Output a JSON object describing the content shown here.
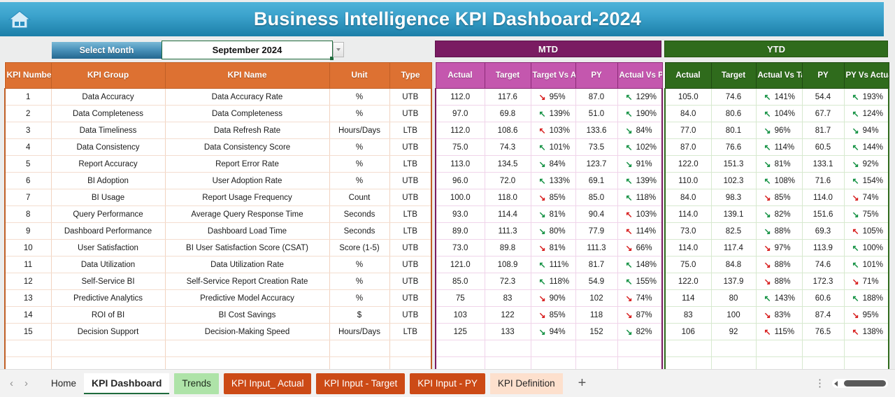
{
  "header": {
    "title": "Business Intelligence KPI Dashboard-2024",
    "home_icon": "home-icon"
  },
  "controls": {
    "select_month_label": "Select Month",
    "month_value": "September 2024",
    "dropdown_icon": "chevron-down-icon"
  },
  "groups": {
    "mtd": "MTD",
    "ytd": "YTD"
  },
  "columns": {
    "left": [
      "KPI Number",
      "KPI Group",
      "KPI Name",
      "Unit",
      "Type"
    ],
    "mtd": [
      "Actual",
      "Target",
      "Target Vs Actual",
      "PY",
      "Actual Vs PY"
    ],
    "ytd": [
      "Actual",
      "Target",
      "Actual Vs Target",
      "PY",
      "PY Vs Actual"
    ]
  },
  "rows": [
    {
      "n": "1",
      "group": "Data Accuracy",
      "name": "Data Accuracy Rate",
      "unit": "%",
      "type": "UTB",
      "mtd": {
        "actual": "112.0",
        "target": "117.6",
        "tva": "95%",
        "tva_dir": "down",
        "tva_col": "dn",
        "py": "87.0",
        "avp": "129%",
        "avp_dir": "up",
        "avp_col": "up"
      },
      "ytd": {
        "actual": "105.0",
        "target": "74.6",
        "avt": "141%",
        "avt_dir": "up",
        "avt_col": "up",
        "py": "54.4",
        "pva": "193%",
        "pva_dir": "up",
        "pva_col": "up"
      }
    },
    {
      "n": "2",
      "group": "Data Completeness",
      "name": "Data Completeness",
      "unit": "%",
      "type": "UTB",
      "mtd": {
        "actual": "97.0",
        "target": "69.8",
        "tva": "139%",
        "tva_dir": "up",
        "tva_col": "up",
        "py": "51.0",
        "avp": "190%",
        "avp_dir": "up",
        "avp_col": "up"
      },
      "ytd": {
        "actual": "84.0",
        "target": "80.6",
        "avt": "104%",
        "avt_dir": "up",
        "avt_col": "up",
        "py": "67.7",
        "pva": "124%",
        "pva_dir": "up",
        "pva_col": "up"
      }
    },
    {
      "n": "3",
      "group": "Data Timeliness",
      "name": "Data Refresh Rate",
      "unit": "Hours/Days",
      "type": "LTB",
      "mtd": {
        "actual": "112.0",
        "target": "108.6",
        "tva": "103%",
        "tva_dir": "up",
        "tva_col": "dn",
        "py": "133.6",
        "avp": "84%",
        "avp_dir": "down",
        "avp_col": "up"
      },
      "ytd": {
        "actual": "77.0",
        "target": "80.1",
        "avt": "96%",
        "avt_dir": "down",
        "avt_col": "up",
        "py": "81.7",
        "pva": "94%",
        "pva_dir": "down",
        "pva_col": "up"
      }
    },
    {
      "n": "4",
      "group": "Data Consistency",
      "name": "Data Consistency Score",
      "unit": "%",
      "type": "UTB",
      "mtd": {
        "actual": "75.0",
        "target": "74.3",
        "tva": "101%",
        "tva_dir": "up",
        "tva_col": "up",
        "py": "73.5",
        "avp": "102%",
        "avp_dir": "up",
        "avp_col": "up"
      },
      "ytd": {
        "actual": "87.0",
        "target": "76.6",
        "avt": "114%",
        "avt_dir": "up",
        "avt_col": "up",
        "py": "60.5",
        "pva": "144%",
        "pva_dir": "up",
        "pva_col": "up"
      }
    },
    {
      "n": "5",
      "group": "Report Accuracy",
      "name": "Report Error Rate",
      "unit": "%",
      "type": "LTB",
      "mtd": {
        "actual": "113.0",
        "target": "134.5",
        "tva": "84%",
        "tva_dir": "down",
        "tva_col": "up",
        "py": "123.7",
        "avp": "91%",
        "avp_dir": "down",
        "avp_col": "up"
      },
      "ytd": {
        "actual": "122.0",
        "target": "151.3",
        "avt": "81%",
        "avt_dir": "down",
        "avt_col": "up",
        "py": "133.1",
        "pva": "92%",
        "pva_dir": "down",
        "pva_col": "up"
      }
    },
    {
      "n": "6",
      "group": "BI Adoption",
      "name": "User Adoption Rate",
      "unit": "%",
      "type": "UTB",
      "mtd": {
        "actual": "96.0",
        "target": "72.0",
        "tva": "133%",
        "tva_dir": "up",
        "tva_col": "up",
        "py": "69.1",
        "avp": "139%",
        "avp_dir": "up",
        "avp_col": "up"
      },
      "ytd": {
        "actual": "110.0",
        "target": "102.3",
        "avt": "108%",
        "avt_dir": "up",
        "avt_col": "up",
        "py": "71.6",
        "pva": "154%",
        "pva_dir": "up",
        "pva_col": "up"
      }
    },
    {
      "n": "7",
      "group": "BI Usage",
      "name": "Report Usage Frequency",
      "unit": "Count",
      "type": "UTB",
      "mtd": {
        "actual": "100.0",
        "target": "118.0",
        "tva": "85%",
        "tva_dir": "down",
        "tva_col": "dn",
        "py": "85.0",
        "avp": "118%",
        "avp_dir": "up",
        "avp_col": "up"
      },
      "ytd": {
        "actual": "84.0",
        "target": "98.3",
        "avt": "85%",
        "avt_dir": "down",
        "avt_col": "dn",
        "py": "114.0",
        "pva": "74%",
        "pva_dir": "down",
        "pva_col": "dn"
      }
    },
    {
      "n": "8",
      "group": "Query Performance",
      "name": "Average Query Response Time",
      "unit": "Seconds",
      "type": "LTB",
      "mtd": {
        "actual": "93.0",
        "target": "114.4",
        "tva": "81%",
        "tva_dir": "down",
        "tva_col": "up",
        "py": "90.4",
        "avp": "103%",
        "avp_dir": "up",
        "avp_col": "dn"
      },
      "ytd": {
        "actual": "114.0",
        "target": "139.1",
        "avt": "82%",
        "avt_dir": "down",
        "avt_col": "up",
        "py": "151.6",
        "pva": "75%",
        "pva_dir": "down",
        "pva_col": "up"
      }
    },
    {
      "n": "9",
      "group": "Dashboard Performance",
      "name": "Dashboard Load Time",
      "unit": "Seconds",
      "type": "LTB",
      "mtd": {
        "actual": "89.0",
        "target": "111.3",
        "tva": "80%",
        "tva_dir": "down",
        "tva_col": "up",
        "py": "77.9",
        "avp": "114%",
        "avp_dir": "up",
        "avp_col": "dn"
      },
      "ytd": {
        "actual": "73.0",
        "target": "82.5",
        "avt": "88%",
        "avt_dir": "down",
        "avt_col": "up",
        "py": "69.3",
        "pva": "105%",
        "pva_dir": "up",
        "pva_col": "dn"
      }
    },
    {
      "n": "10",
      "group": "User Satisfaction",
      "name": "BI User Satisfaction Score (CSAT)",
      "unit": "Score (1-5)",
      "type": "UTB",
      "mtd": {
        "actual": "73.0",
        "target": "89.8",
        "tva": "81%",
        "tva_dir": "down",
        "tva_col": "dn",
        "py": "111.3",
        "avp": "66%",
        "avp_dir": "down",
        "avp_col": "dn"
      },
      "ytd": {
        "actual": "114.0",
        "target": "117.4",
        "avt": "97%",
        "avt_dir": "down",
        "avt_col": "dn",
        "py": "113.9",
        "pva": "100%",
        "pva_dir": "up",
        "pva_col": "up"
      }
    },
    {
      "n": "11",
      "group": "Data Utilization",
      "name": "Data Utilization Rate",
      "unit": "%",
      "type": "UTB",
      "mtd": {
        "actual": "121.0",
        "target": "108.9",
        "tva": "111%",
        "tva_dir": "up",
        "tva_col": "up",
        "py": "81.7",
        "avp": "148%",
        "avp_dir": "up",
        "avp_col": "up"
      },
      "ytd": {
        "actual": "75.0",
        "target": "84.8",
        "avt": "88%",
        "avt_dir": "down",
        "avt_col": "dn",
        "py": "74.6",
        "pva": "101%",
        "pva_dir": "up",
        "pva_col": "up"
      }
    },
    {
      "n": "12",
      "group": "Self-Service BI",
      "name": "Self-Service Report Creation Rate",
      "unit": "%",
      "type": "UTB",
      "mtd": {
        "actual": "85.0",
        "target": "72.3",
        "tva": "118%",
        "tva_dir": "up",
        "tva_col": "up",
        "py": "54.9",
        "avp": "155%",
        "avp_dir": "up",
        "avp_col": "up"
      },
      "ytd": {
        "actual": "122.0",
        "target": "137.9",
        "avt": "88%",
        "avt_dir": "down",
        "avt_col": "dn",
        "py": "172.3",
        "pva": "71%",
        "pva_dir": "down",
        "pva_col": "dn"
      }
    },
    {
      "n": "13",
      "group": "Predictive Analytics",
      "name": "Predictive Model Accuracy",
      "unit": "%",
      "type": "UTB",
      "mtd": {
        "actual": "75",
        "target": "83",
        "tva": "90%",
        "tva_dir": "down",
        "tva_col": "dn",
        "py": "102",
        "avp": "74%",
        "avp_dir": "down",
        "avp_col": "dn"
      },
      "ytd": {
        "actual": "114",
        "target": "80",
        "avt": "143%",
        "avt_dir": "up",
        "avt_col": "up",
        "py": "60.6",
        "pva": "188%",
        "pva_dir": "up",
        "pva_col": "up"
      }
    },
    {
      "n": "14",
      "group": "ROI of BI",
      "name": "BI Cost Savings",
      "unit": "$",
      "type": "UTB",
      "mtd": {
        "actual": "103",
        "target": "122",
        "tva": "85%",
        "tva_dir": "down",
        "tva_col": "dn",
        "py": "118",
        "avp": "87%",
        "avp_dir": "down",
        "avp_col": "dn"
      },
      "ytd": {
        "actual": "83",
        "target": "100",
        "avt": "83%",
        "avt_dir": "down",
        "avt_col": "dn",
        "py": "87.4",
        "pva": "95%",
        "pva_dir": "down",
        "pva_col": "dn"
      }
    },
    {
      "n": "15",
      "group": "Decision Support",
      "name": "Decision-Making Speed",
      "unit": "Hours/Days",
      "type": "LTB",
      "mtd": {
        "actual": "125",
        "target": "133",
        "tva": "94%",
        "tva_dir": "down",
        "tva_col": "up",
        "py": "152",
        "avp": "82%",
        "avp_dir": "down",
        "avp_col": "up"
      },
      "ytd": {
        "actual": "106",
        "target": "92",
        "avt": "115%",
        "avt_dir": "up",
        "avt_col": "dn",
        "py": "76.5",
        "pva": "138%",
        "pva_dir": "up",
        "pva_col": "dn"
      }
    }
  ],
  "tabbar": {
    "prev_icon": "chevron-left-icon",
    "next_icon": "chevron-right-icon",
    "tabs": [
      {
        "label": "Home",
        "style": "plain"
      },
      {
        "label": "KPI Dashboard",
        "style": "active"
      },
      {
        "label": "Trends",
        "style": "green"
      },
      {
        "label": "KPI Input_ Actual",
        "style": "orange"
      },
      {
        "label": "KPI Input - Target",
        "style": "orange"
      },
      {
        "label": "KPI Input - PY",
        "style": "orange"
      },
      {
        "label": "KPI Definition",
        "style": "peach"
      }
    ],
    "add_label": "+",
    "kebab_icon": "more-options-icon",
    "scroll_icon": "horizontal-scrollbar"
  },
  "colors": {
    "title_blue": "#3ba2cc",
    "kpi_orange": "#dd7132",
    "mtd_purple": "#7a1b62",
    "mtd_pink": "#c457ae",
    "ytd_green": "#2f6b1c",
    "up_green": "#159244",
    "down_red": "#d81f1f"
  }
}
